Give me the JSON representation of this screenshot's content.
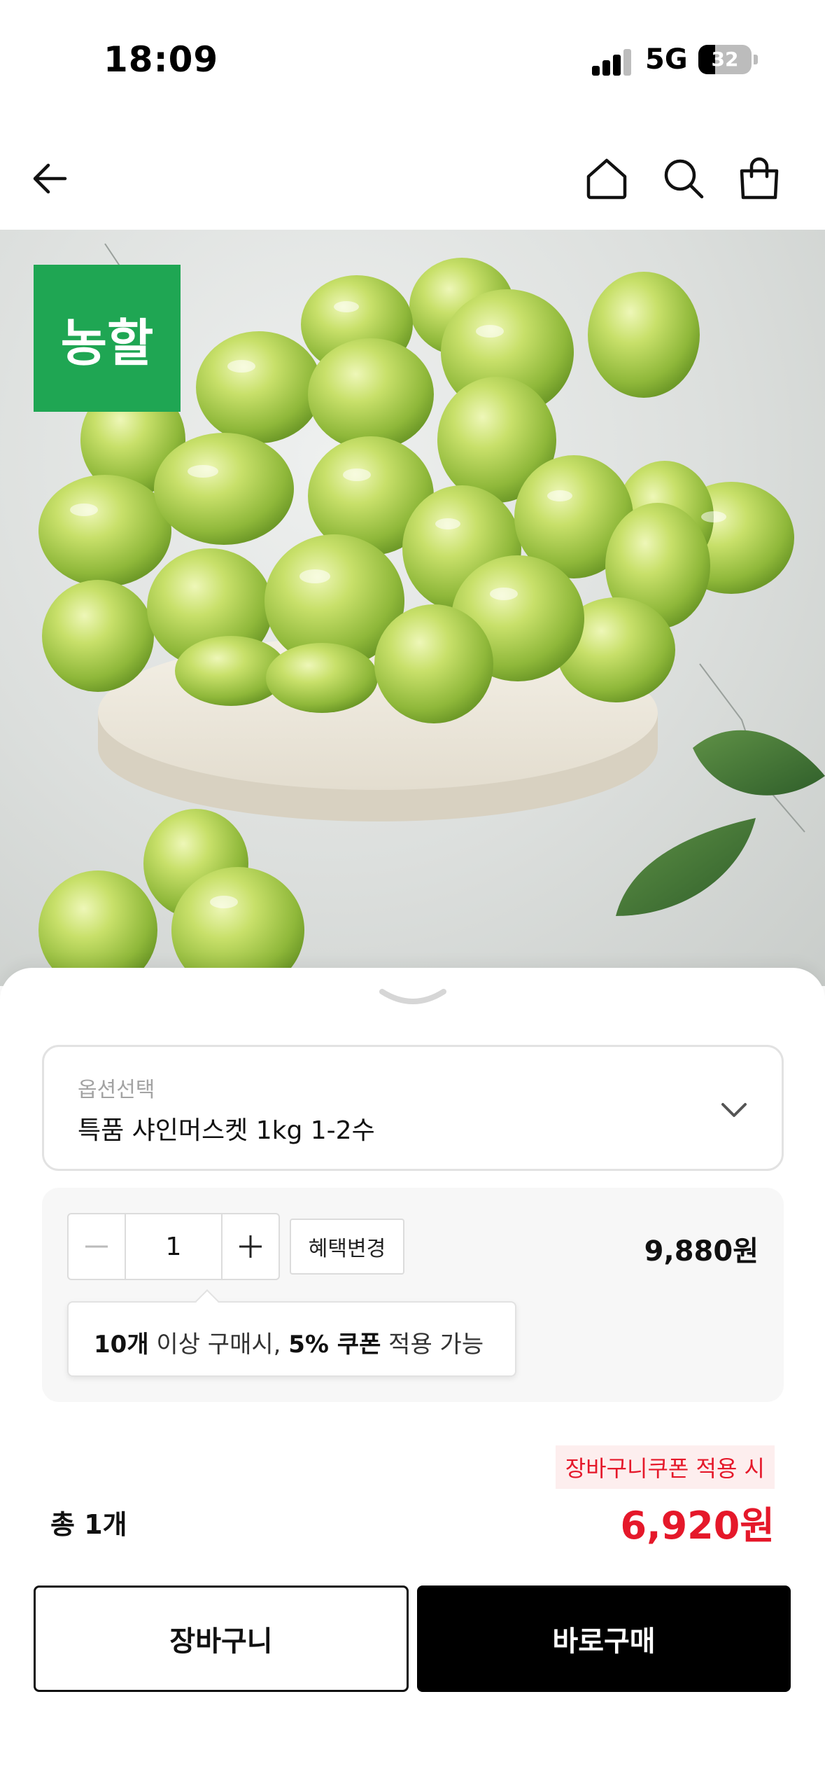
{
  "status_bar": {
    "time": "18:09",
    "network": "5G",
    "battery": "32",
    "battery_level": 0.32
  },
  "nav": {
    "icons": [
      "back-arrow-icon",
      "home-icon",
      "search-icon",
      "shopping-bag-icon"
    ]
  },
  "product": {
    "brand_badge": "농할"
  },
  "option": {
    "label": "옵션선택",
    "value": "특품 샤인머스켓 1kg 1-2수"
  },
  "quantity": {
    "value": "1",
    "benefit_button": "혜택변경",
    "price": "9,880원",
    "tooltip": {
      "count": "10개",
      "mid": " 이상 구매시, ",
      "coupon": "5% 쿠폰",
      "end": " 적용 가능"
    }
  },
  "summary": {
    "coupon_tag": "장바구니쿠폰 적용 시",
    "total_label": "총 1개",
    "total_price": "6,920원"
  },
  "actions": {
    "cart": "장바구니",
    "buy_now": "바로구매"
  },
  "colors": {
    "accent_red": "#e5182a",
    "brand_green": "#1fa653",
    "black": "#000000"
  }
}
